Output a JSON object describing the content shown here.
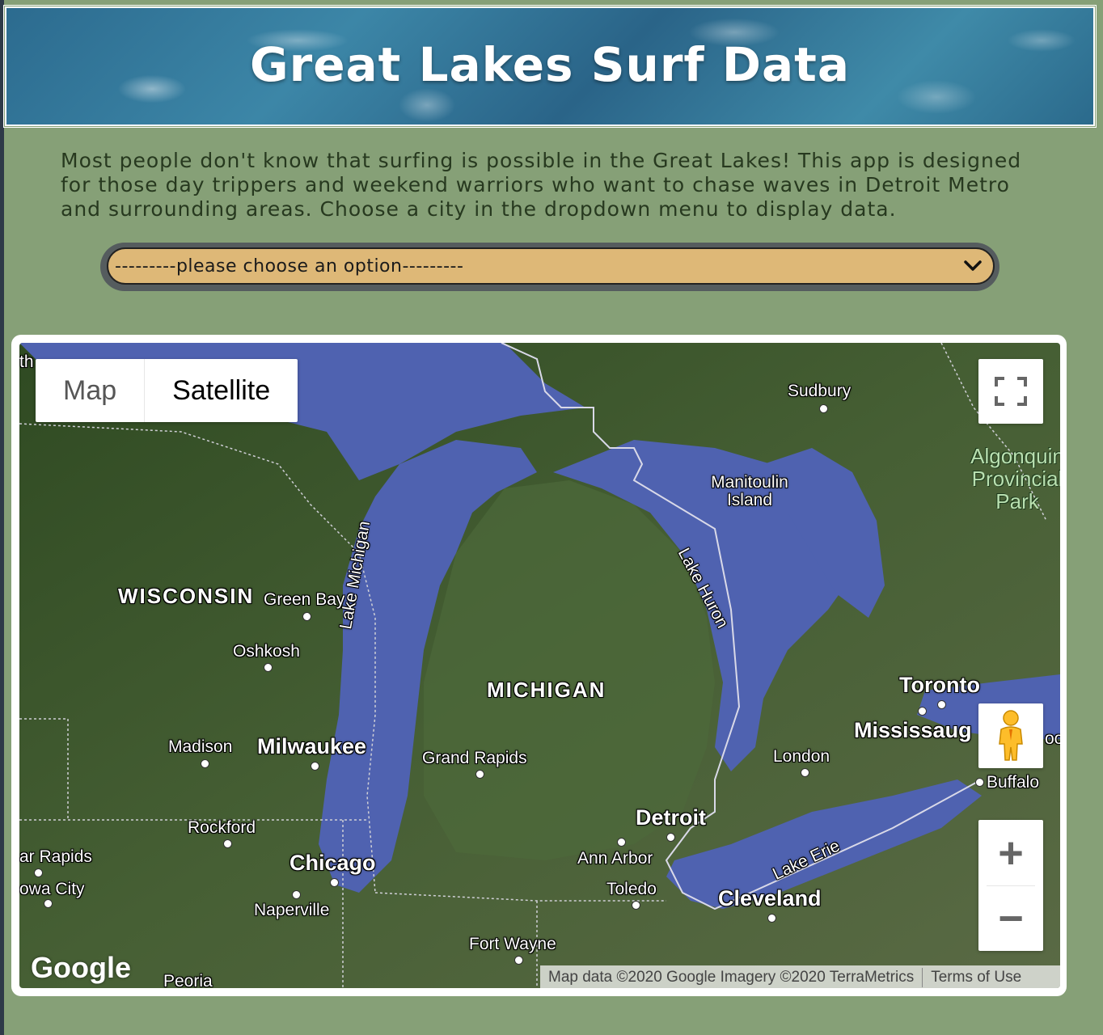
{
  "header": {
    "title": "Great Lakes Surf Data"
  },
  "intro": {
    "text": "Most people don't know that surfing is possible in the Great Lakes! This app is designed for those day trippers and weekend warriors who want to chase waves in Detroit Metro and surrounding areas. Choose a city in the dropdown menu to display data."
  },
  "city_select": {
    "selected": "---------please choose an option---------",
    "icon": "chevron-down-icon"
  },
  "map": {
    "type_control": {
      "map_label": "Map",
      "satellite_label": "Satellite",
      "active": "Satellite"
    },
    "zoom": {
      "in_label": "+",
      "out_label": "−"
    },
    "icons": {
      "fullscreen": "fullscreen-icon",
      "pegman": "pegman-icon"
    },
    "logo": "Google",
    "attribution": "Map data ©2020 Google Imagery ©2020 TerraMetrics",
    "terms": "Terms of Use",
    "labels": {
      "sudbury": "Sudbury",
      "manitoulin": "Manitoulin Island",
      "algonquin": "Algonquin Provincial Park",
      "wisconsin": "WISCONSIN",
      "green_bay": "Green Bay",
      "oshkosh": "Oshkosh",
      "lake_michigan": "Lake Michigan",
      "lake_huron": "Lake Huron",
      "michigan": "MICHIGAN",
      "toronto": "Toronto",
      "mississauga": "Mississaug",
      "madison": "Madison",
      "milwaukee": "Milwaukee",
      "grand_rapids": "Grand Rapids",
      "london": "London",
      "buffalo": "Buffalo",
      "detroit": "Detroit",
      "rockford": "Rockford",
      "ann_arbor": "Ann Arbor",
      "lake_erie": "Lake Erie",
      "cedar_rapids": "ar Rapids",
      "chicago": "Chicago",
      "toledo": "Toledo",
      "cleveland": "Cleveland",
      "iowa_city": "owa City",
      "naperville": "Naperville",
      "fort_wayne": "Fort Wayne",
      "peoria": "Peoria",
      "edge_th": "th",
      "edge_oo": "oo"
    }
  },
  "colors": {
    "page_bg": "#86a077",
    "select_bg": "#deb877",
    "intro_text": "#27391f",
    "water": "#4f62b0",
    "land": "#3e5a2e"
  }
}
